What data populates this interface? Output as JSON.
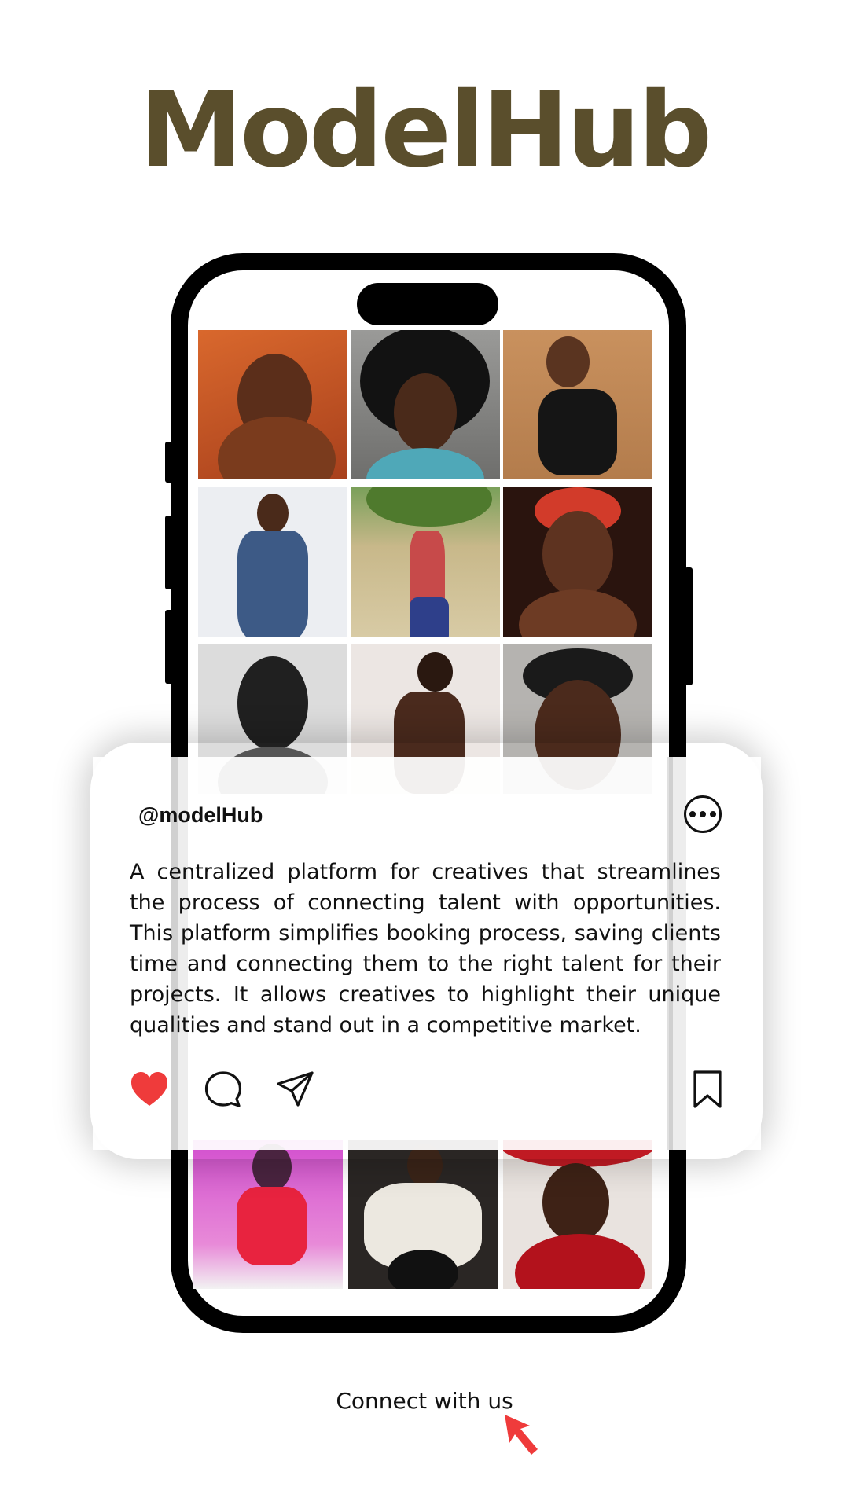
{
  "brand": {
    "name": "ModelHub",
    "color": "#5a4e2c"
  },
  "post": {
    "handle": "@modelHub",
    "description": "A centralized platform for creatives that streamlines the process of connecting talent with opportunities. This platform simplifies booking process, saving clients time and connecting them to the right talent for their projects. It allows creatives to highlight their unique qualities and stand out in a competitive market.",
    "liked": true,
    "like_color": "#ef3b3b",
    "actions": [
      "heart-icon",
      "comment-icon",
      "share-icon",
      "bookmark-icon"
    ]
  },
  "gallery": {
    "photos": [
      "orange-portrait",
      "afro-portrait",
      "black-dress-pose",
      "blue-suit",
      "palm-tree-pose",
      "red-headwrap",
      "monochrome-portrait",
      "backless-dress",
      "hands-on-head",
      "pink-runway",
      "white-tuxedo",
      "red-hat"
    ]
  },
  "cta": {
    "label": "Connect with us",
    "cursor_color": "#ef3b3b"
  }
}
